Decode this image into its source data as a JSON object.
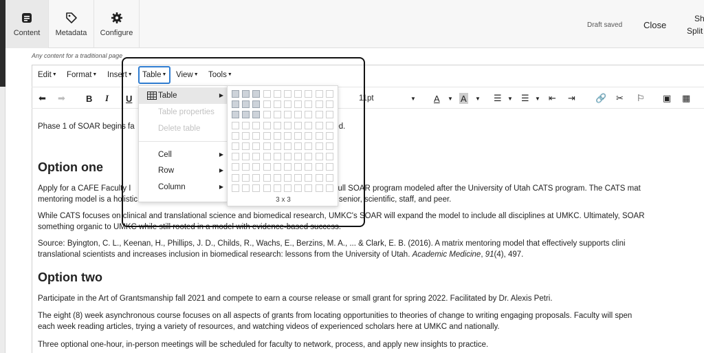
{
  "header": {
    "tabs": [
      {
        "label": "Content",
        "icon": "document-icon",
        "active": true
      },
      {
        "label": "Metadata",
        "icon": "tag-icon",
        "active": false
      },
      {
        "label": "Configure",
        "icon": "gear-icon",
        "active": false
      }
    ],
    "status": "Draft saved",
    "close_label": "Close",
    "cut_label_top": "Sh",
    "cut_label_bottom": "Split"
  },
  "editor": {
    "hint": "Any content for a traditional page",
    "menubar": [
      "Edit",
      "Format",
      "Insert",
      "Table",
      "View",
      "Tools"
    ],
    "open_menu": "Table",
    "font_size": "11pt",
    "content": {
      "p1a": "Phase 1 of SOAR begins fa",
      "p1b": "ved.",
      "h_option_one": "Option one",
      "p2_l1a": "Apply for a CAFE Faculty I",
      "p2_l1b": "n the full SOAR program modeled after the University of Utah CATS program. The CATS mat",
      "p2_l2a": "mentoring model is a holistic framework that inc",
      "p2_l2b": ": self, senior, scientific, staff, and peer.",
      "p3_l1a": "While CATS focuses on clinical and translational science and biomedical research, UMKC's SOAR will expand the model to include all disciplines at UMKC. Ultimately, SOAR",
      "p3_l2": "something organic to UMKC while still rooted in a model with evidence-based success.",
      "p4_l1": "Source: Byington, C. L., Keenan, H., Phillips, J. D., Childs, R., Wachs, E., Berzins, M. A., ... & Clark, E. B. (2016). A matrix mentoring model that effectively supports clini",
      "p4_l2a": "translational scientists and increases inclusion in biomedical research: lessons from the University of Utah. ",
      "p4_l2_journal": "Academic Medicine",
      "p4_l2_sep": ", ",
      "p4_l2_vol": "91",
      "p4_l2_end": "(4), 497.",
      "h_option_two": "Option two",
      "p5": "Participate in the Art of Grantsmanship fall 2021 and compete to earn a course release or small grant for spring 2022. Facilitated by Dr. Alexis Petri.",
      "p6_l1": "The eight (8) week asynchronous course focuses on all aspects of grants from locating opportunities to theories of change to writing engaging proposals. Faculty will spen",
      "p6_l2": "each week reading articles, trying a variety of resources, and watching videos of experienced scholars here at UMKC and nationally.",
      "p7": "Three optional one-hour, in-person meetings will be scheduled for faculty to network, process, and apply new insights to practice."
    }
  },
  "table_menu": {
    "items": [
      {
        "label": "Table",
        "submenu": true,
        "highlighted": true,
        "disabled": false
      },
      {
        "label": "Table properties",
        "submenu": false,
        "highlighted": false,
        "disabled": true
      },
      {
        "label": "Delete table",
        "submenu": false,
        "highlighted": false,
        "disabled": true
      },
      {
        "label": "Cell",
        "submenu": true,
        "highlighted": false,
        "disabled": false
      },
      {
        "label": "Row",
        "submenu": true,
        "highlighted": false,
        "disabled": false
      },
      {
        "label": "Column",
        "submenu": true,
        "highlighted": false,
        "disabled": false
      }
    ]
  },
  "grid_picker": {
    "columns": 10,
    "rows": 10,
    "selected_cols": 3,
    "selected_rows": 3,
    "label": "3 x 3"
  },
  "colors": {
    "accent_blue": "#2f7dd1",
    "selected_cell": "#cdd3da"
  }
}
